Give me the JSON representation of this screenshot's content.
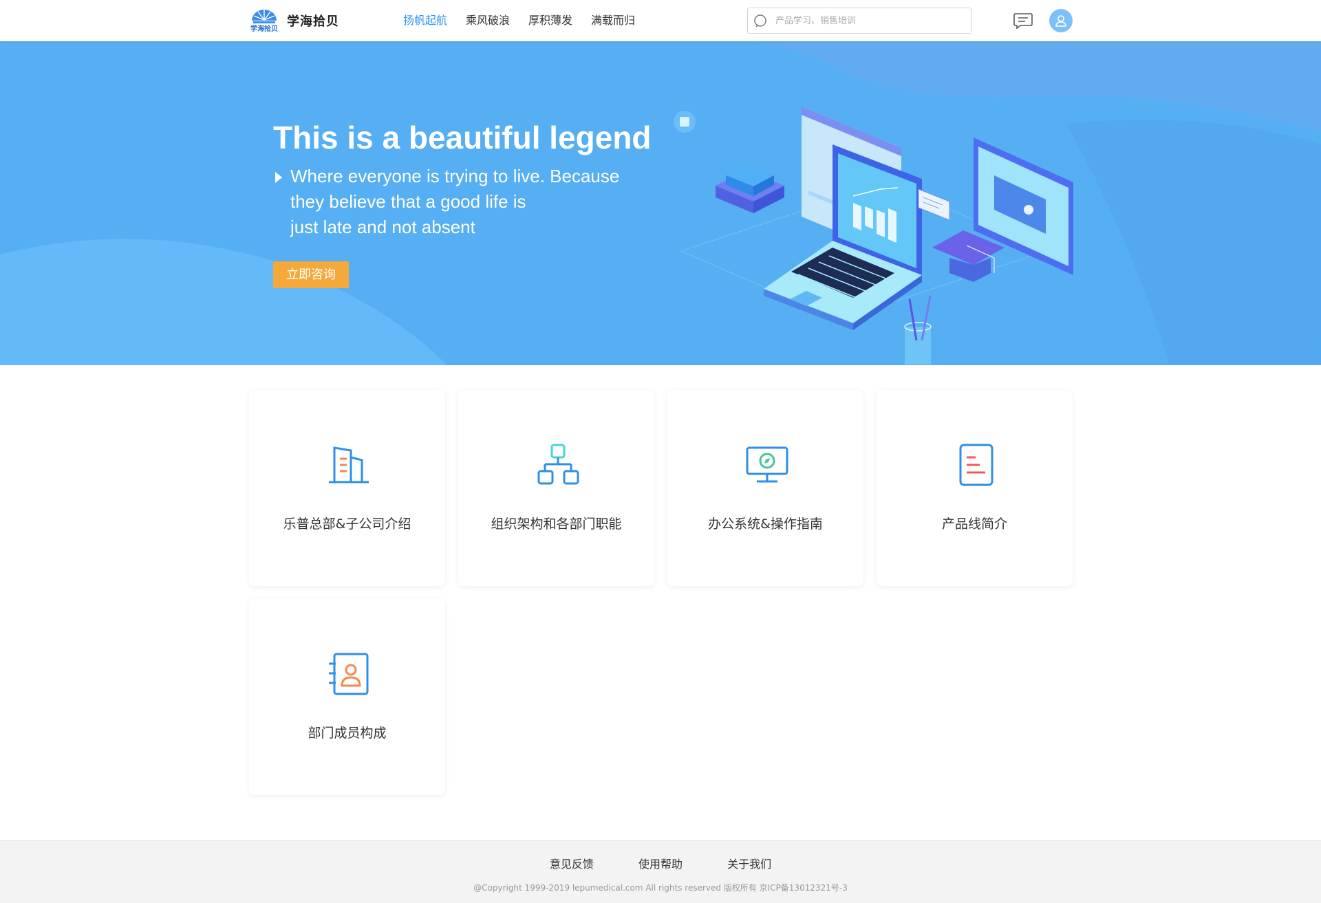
{
  "header": {
    "brand": "学海拾贝",
    "nav": [
      "扬帆起航",
      "乘风破浪",
      "厚积薄发",
      "满载而归"
    ],
    "active_nav": "扬帆起航",
    "search_placeholder": "产品学习、销售培训",
    "logo_text": "学海拾贝",
    "icons": {
      "search": "search-icon",
      "message": "message-icon",
      "avatar": "user-icon"
    }
  },
  "banner": {
    "title": "This is a beautiful legend",
    "lines": [
      "Where everyone is trying to live. Because",
      "they believe that a good life is",
      "just late and not absent"
    ],
    "button": "立即咨询"
  },
  "cards": [
    {
      "label": "乐普总部&子公司介绍",
      "icon": "building-icon"
    },
    {
      "label": "组织架构和各部门职能",
      "icon": "org-chart-icon"
    },
    {
      "label": "办公系统&操作指南",
      "icon": "monitor-compass-icon"
    },
    {
      "label": "产品线简介",
      "icon": "document-icon"
    },
    {
      "label": "部门成员构成",
      "icon": "contact-book-icon"
    }
  ],
  "footer": {
    "links": [
      "意见反馈",
      "使用帮助",
      "关于我们"
    ],
    "copyright": "@Copyright 1999-2019 lepumedical.com All rights reserved    版权所有 京ICP备13012321号-3"
  },
  "colors": {
    "accent": "#2d95f3",
    "banner": "#56aef3",
    "button": "#f6a93b"
  }
}
